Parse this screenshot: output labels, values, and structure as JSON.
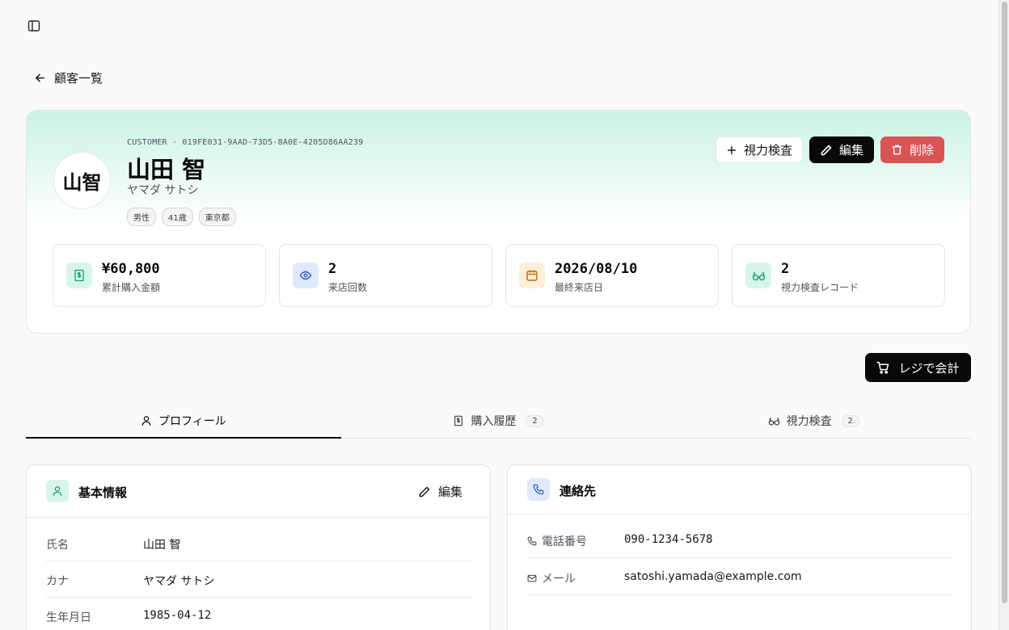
{
  "nav": {
    "back_label": "顧客一覧"
  },
  "customer": {
    "id_line": "CUSTOMER · 019FE031-9AAD-73D5-8A0E-4205D86AA239",
    "name": "山田 智",
    "kana": "ヤマダ サトシ",
    "avatar_initials": "山智",
    "tags": [
      "男性",
      "41歳",
      "東京都"
    ]
  },
  "actions": {
    "vision_test_label": "視力検査",
    "edit_label": "編集",
    "delete_label": "削除"
  },
  "stats": [
    {
      "value": "¥60,800",
      "label": "累計購入金額",
      "icon": "receipt-icon",
      "icon_bg": "#d8f5ea",
      "icon_color": "#0f9d78"
    },
    {
      "value": "2",
      "label": "来店回数",
      "icon": "eye-icon",
      "icon_bg": "#e0e9fb",
      "icon_color": "#2f5fb8"
    },
    {
      "value": "2026/08/10",
      "label": "最終来店日",
      "icon": "calendar-icon",
      "icon_bg": "#fcefd9",
      "icon_color": "#c26a0b"
    },
    {
      "value": "2",
      "label": "視力検査レコード",
      "icon": "glasses-icon",
      "icon_bg": "#d8f5ea",
      "icon_color": "#0f9d78"
    }
  ],
  "register_button": "レジで会計",
  "tabs": [
    {
      "label": "プロフィール",
      "icon": "user-icon",
      "count": null,
      "active": true
    },
    {
      "label": "購入履歴",
      "icon": "receipt-icon",
      "count": "2",
      "active": false
    },
    {
      "label": "視力検査",
      "icon": "glasses-icon",
      "count": "2",
      "active": false
    }
  ],
  "basic_info": {
    "title": "基本情報",
    "edit_label": "編集",
    "rows": [
      {
        "label": "氏名",
        "value": "山田 智"
      },
      {
        "label": "カナ",
        "value": "ヤマダ サトシ"
      },
      {
        "label": "生年月日",
        "value": "1985-04-12"
      }
    ]
  },
  "contact": {
    "title": "連絡先",
    "rows": [
      {
        "label": "電話番号",
        "value": "090-1234-5678",
        "icon": "phone-icon"
      },
      {
        "label": "メール",
        "value": "satoshi.yamada@example.com",
        "icon": "mail-icon"
      }
    ]
  },
  "colors": {
    "accent_mint": "#c9f3e6",
    "danger": "#d95454",
    "primary": "#09090b"
  }
}
